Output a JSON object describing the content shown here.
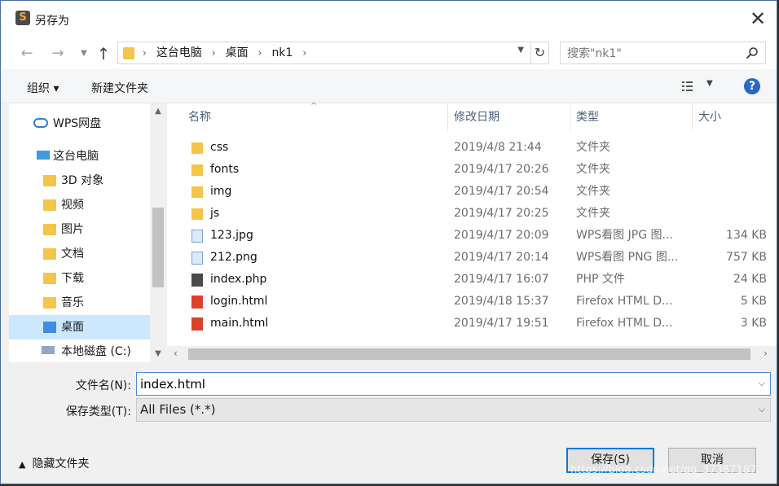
{
  "window": {
    "title": "另存为",
    "close_glyph": "✕"
  },
  "address": {
    "crumbs": [
      "这台电脑",
      "桌面",
      "nk1"
    ],
    "search_placeholder": "搜索\"nk1\""
  },
  "toolbar": {
    "organize": "组织 ▾",
    "new_folder": "新建文件夹",
    "help": "?"
  },
  "nav": {
    "items": [
      {
        "label": "WPS网盘",
        "icon": "cloud-icon"
      },
      {
        "label": "这台电脑",
        "icon": "computer-icon"
      },
      {
        "label": "3D 对象",
        "icon": "3d-objects-icon"
      },
      {
        "label": "视频",
        "icon": "video-folder-icon"
      },
      {
        "label": "图片",
        "icon": "pictures-folder-icon"
      },
      {
        "label": "文档",
        "icon": "documents-folder-icon"
      },
      {
        "label": "下载",
        "icon": "download-folder-icon"
      },
      {
        "label": "音乐",
        "icon": "music-folder-icon"
      },
      {
        "label": "桌面",
        "icon": "desktop-folder-icon",
        "selected": true
      },
      {
        "label": "本地磁盘 (C:)",
        "icon": "drive-icon"
      }
    ]
  },
  "columns": {
    "name": "名称",
    "modified": "修改日期",
    "type": "类型",
    "size": "大小"
  },
  "files": [
    {
      "name": "css",
      "modified": "2019/4/8 21:44",
      "type": "文件夹",
      "size": "",
      "kind": "folder"
    },
    {
      "name": "fonts",
      "modified": "2019/4/17 20:26",
      "type": "文件夹",
      "size": "",
      "kind": "folder"
    },
    {
      "name": "img",
      "modified": "2019/4/17 20:54",
      "type": "文件夹",
      "size": "",
      "kind": "folder"
    },
    {
      "name": "js",
      "modified": "2019/4/17 20:25",
      "type": "文件夹",
      "size": "",
      "kind": "folder"
    },
    {
      "name": "123.jpg",
      "modified": "2019/4/17 20:09",
      "type": "WPS看图 JPG 图...",
      "size": "134 KB",
      "kind": "image"
    },
    {
      "name": "212.png",
      "modified": "2019/4/17 20:14",
      "type": "WPS看图 PNG 图...",
      "size": "757 KB",
      "kind": "image"
    },
    {
      "name": "index.php",
      "modified": "2019/4/17 16:07",
      "type": "PHP 文件",
      "size": "24 KB",
      "kind": "php"
    },
    {
      "name": "login.html",
      "modified": "2019/4/18 15:37",
      "type": "Firefox HTML D...",
      "size": "5 KB",
      "kind": "html"
    },
    {
      "name": "main.html",
      "modified": "2019/4/17 19:51",
      "type": "Firefox HTML D...",
      "size": "3 KB",
      "kind": "html"
    }
  ],
  "form": {
    "filename_label": "文件名(N):",
    "filename_value": "index.html",
    "filetype_label": "保存类型(T):",
    "filetype_value": "All Files (*.*)"
  },
  "footer": {
    "hide_folders": "隐藏文件夹",
    "save": "保存(S)",
    "cancel": "取消",
    "watermark": "https://blog.csdn.net/qq_37387187"
  },
  "colors": {
    "accent": "#0078d7",
    "selected": "#cce8ff",
    "folder": "#f4c54b"
  }
}
